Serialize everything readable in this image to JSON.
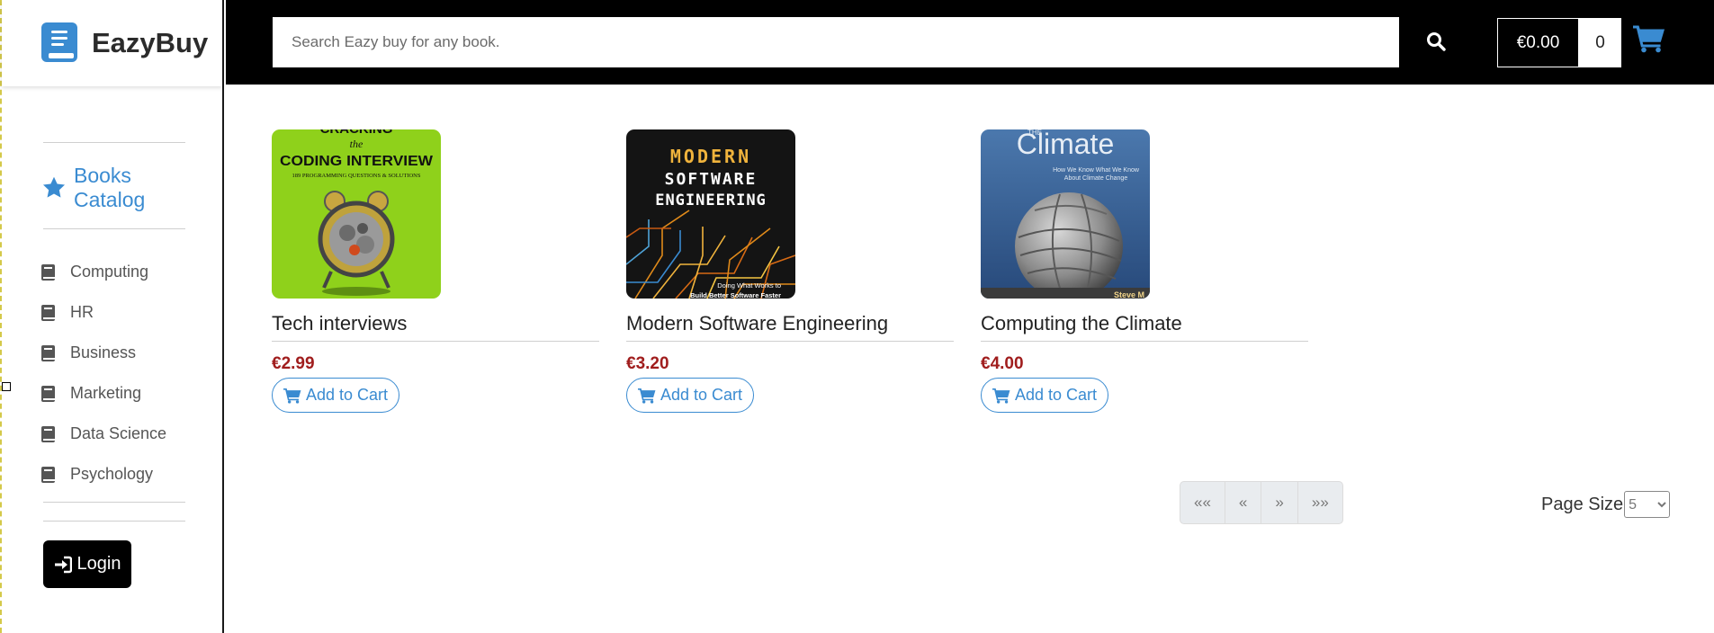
{
  "brand": {
    "name": "EazyBuy"
  },
  "sidebar": {
    "catalog_label": "Books Catalog",
    "categories": [
      {
        "label": "Computing"
      },
      {
        "label": "HR"
      },
      {
        "label": "Business"
      },
      {
        "label": "Marketing"
      },
      {
        "label": "Data Science"
      },
      {
        "label": "Psychology"
      }
    ],
    "login_label": "Login"
  },
  "header": {
    "search_placeholder": "Search Eazy buy for any book.",
    "cart_total": "€0.00",
    "cart_count": "0"
  },
  "products": [
    {
      "title": "Tech interviews",
      "price": "€2.99",
      "add_label": "Add to Cart",
      "cover": {
        "line1": "CRACKING",
        "line2": "the",
        "line3": "CODING INTERVIEW",
        "line4": "189 PROGRAMMING QUESTIONS & SOLUTIONS",
        "bg": "#8fd11b"
      }
    },
    {
      "title": "Modern Software Engineering",
      "price": "€3.20",
      "add_label": "Add to Cart",
      "cover": {
        "line1": "MODERN",
        "line2": "SOFTWARE",
        "line3": "ENGINEERING",
        "line4": "Doing What Works to",
        "line5": "Build Better Software Faster",
        "bg": "#141414"
      }
    },
    {
      "title": "Computing the Climate",
      "price": "€4.00",
      "add_label": "Add to Cart",
      "cover": {
        "line1": "THE",
        "line2": "Climate",
        "line3": "How We Know What We Know",
        "line4": "About Climate Change",
        "line5": "Steve M",
        "bg": "#3f6699"
      }
    }
  ],
  "pagination": {
    "first": "«« ",
    "prev": "«",
    "next": "»",
    "last": "»»",
    "page_size_label": "Page Size",
    "page_size_value": "5"
  },
  "colors": {
    "accent": "#3a8bd1",
    "price": "#a01d1d",
    "topbar": "#000000"
  }
}
